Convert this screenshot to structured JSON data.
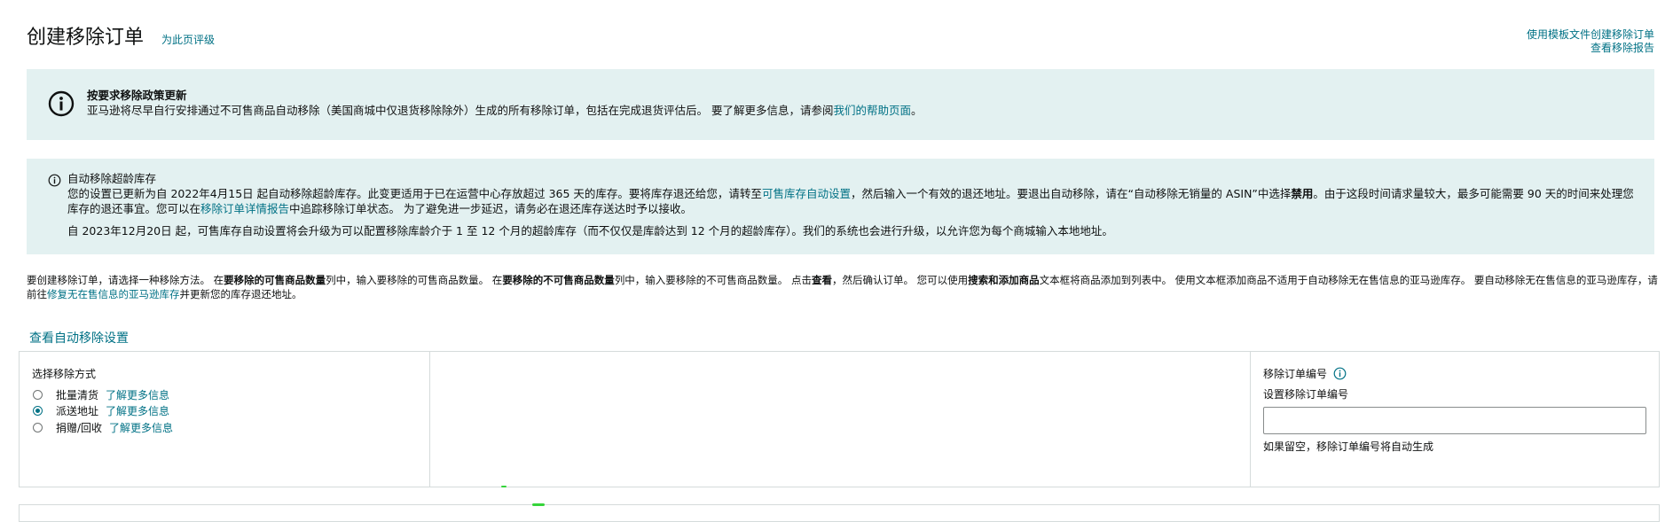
{
  "header": {
    "title": "创建移除订单",
    "rate_link": "为此页评级"
  },
  "top_right_links": {
    "template_create": "使用模板文件创建移除订单",
    "view_report": "查看移除报告"
  },
  "policy_banner": {
    "title": "按要求移除政策更新",
    "body": "亚马逊将尽早自行安排通过不可售商品自动移除（美国商城中仅退货移除除外）生成的所有移除订单，包括在完成退货评估后。 要了解更多信息，请参阅",
    "help_link": "我们的帮助页面",
    "end": "。"
  },
  "aged_banner": {
    "title": "自动移除超龄库存",
    "p1_a": "您的设置已更新为自 2022年4月15日 起自动移除超龄库存。此变更适用于已在运营中心存放超过 365 天的库存。要将库存退还给您，请转至",
    "p1_link": "可售库存自动设置",
    "p1_b": "，然后输入一个有效的退还地址。要退出自动移除，请在“自动移除无销量的 ASIN”中选择",
    "p1_bold": "禁用",
    "p1_c": "。由于这段时间请求量较大，最多可能需要 90 天的时间来处理您库存的退还事宜。您可以在",
    "p1_link2": "移除订单详情报告",
    "p1_d": "中追踪移除订单状态。 为了避免进一步延迟，请务必在退还库存送达时予以接收。",
    "p2": "自 2023年12月20日 起，可售库存自动设置将会升级为可以配置移除库龄介于 1 至 12 个月的超龄库存（而不仅仅是库龄达到 12 个月的超龄库存）。我们的系统也会进行升级，以允许您为每个商城输入本地地址。"
  },
  "instructions": {
    "t1": "要创建移除订单，请选择一种移除方法。 在",
    "b1": "要移除的可售商品数量",
    "t2": "列中，输入要移除的可售商品数量。 在",
    "b2": "要移除的不可售商品数量",
    "t3": "列中，输入要移除的不可售商品数量。 点击",
    "b3": "查看",
    "t4": "，然后确认订单。 您可以使用",
    "b4": "搜索和添加商品",
    "t5": "文本框将商品添加到列表中。 使用文本框添加商品不适用于自动移除无在售信息的亚马逊库存。 要自动移除无在售信息的亚马逊库存，请前往",
    "link": "修复无在售信息的亚马逊库存",
    "t6": "并更新您的库存退还地址。"
  },
  "auto_removal_link": "查看自动移除设置",
  "removal_method": {
    "label": "选择移除方式",
    "options": [
      {
        "label": "批量清货",
        "learn_more": "了解更多信息",
        "checked": false
      },
      {
        "label": "派送地址",
        "learn_more": "了解更多信息",
        "checked": true
      },
      {
        "label": "捐赠/回收",
        "learn_more": "了解更多信息",
        "checked": false
      }
    ]
  },
  "order_number": {
    "label": "移除订单编号",
    "set_label": "设置移除订单编号",
    "input_value": "",
    "hint": "如果留空，移除订单编号将自动生成"
  },
  "colors": {
    "link": "#007185",
    "banner_bg": "#e3f1f1",
    "border": "#d5dbdb"
  }
}
